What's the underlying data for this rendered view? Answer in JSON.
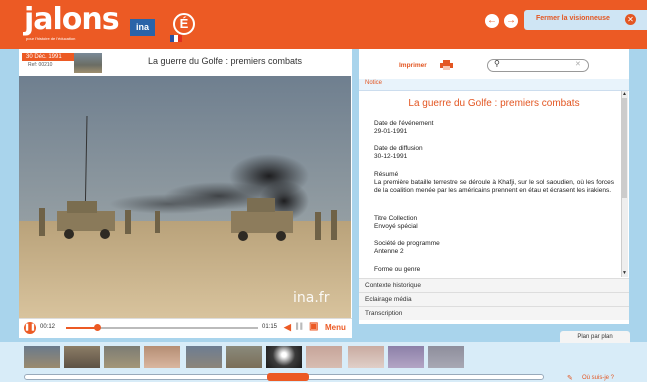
{
  "header": {
    "logo": "jalons",
    "tagline": "pour l'histoire de l'éducation",
    "ina_logo": "ina",
    "e_logo": "É",
    "close_viewer": "Fermer la visionneuse",
    "prev_icon": "left-arrow-icon",
    "next_icon": "right-arrow-icon"
  },
  "video": {
    "date": "30 Déc. 1991",
    "ref": "Ref: 00210",
    "title": "La guerre du Golfe : premiers combats",
    "watermark": "ina.fr",
    "time_current": "00:12",
    "time_total": "01:15",
    "progress": 0.16,
    "menu_label": "Menu"
  },
  "panel": {
    "print_label": "Imprimer",
    "search_placeholder": "",
    "notice_tab": "Notice",
    "notice_title": "La guerre du Golfe : premiers combats",
    "fields": [
      {
        "label": "Date de l'événement",
        "value": "29-01-1991"
      },
      {
        "label": "Date de diffusion",
        "value": "30-12-1991"
      },
      {
        "label": "Résumé",
        "value": "La première bataille terrestre se déroule à Khafji, sur le sol saoudien, où les forces de la coalition menée par les américains prennent en étau et écrasent les irakiens."
      },
      {
        "label": "Titre Collection",
        "value": "Envoyé spécial"
      },
      {
        "label": "Société de programme",
        "value": "Antenne 2"
      },
      {
        "label": "Forme ou genre",
        "value": ""
      }
    ],
    "accordion": [
      "Contexte historique",
      "Eclairage média",
      "Transcription"
    ]
  },
  "filmstrip": {
    "tab_label": "Plan par plan",
    "help_label": "Où suis-je ?"
  },
  "colors": {
    "brand": "#ec5a24",
    "bg": "#a9d4ec"
  }
}
